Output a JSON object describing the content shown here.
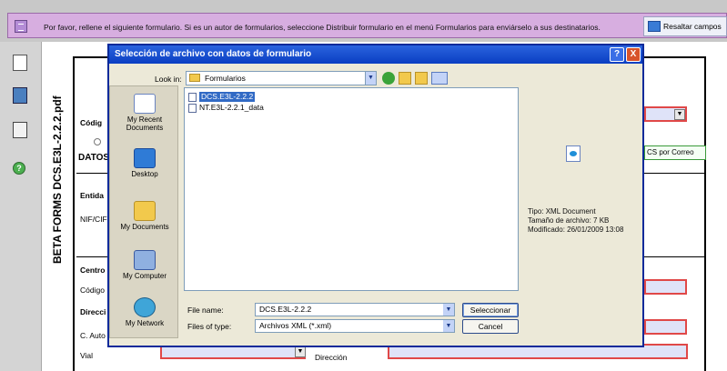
{
  "notice": {
    "text": "Por favor, rellene el siguiente formulario. Si es un autor de formularios, seleccione Distribuir formulario en el menú Formularios para enviárselo a sus destinatarios.",
    "highlight_button": "Resaltar campos"
  },
  "document": {
    "vertical_title": "BETA FORMS DCS.E3L-2.2.2.pdf",
    "labels": {
      "codigo": "Códig",
      "datos": "DATOS",
      "entidad": "Entida",
      "nif": "NIF/CIF",
      "centro": "Centro",
      "codigo2": "Código",
      "direccion_abbr": "Direcci",
      "c_auto": "C. Auto",
      "vial": "Vial",
      "direccion": "Dirección"
    },
    "email_button": "CS por Correo"
  },
  "dialog": {
    "title": "Selección de archivo con datos de formulario",
    "help": "?",
    "close": "X",
    "look_in_label": "Look in:",
    "look_in_value": "Formularios",
    "places": [
      "My Recent Documents",
      "Desktop",
      "My Documents",
      "My Computer",
      "My Network"
    ],
    "files": [
      "DCS.E3L-2.2.2",
      "NT.E3L-2.2.1_data"
    ],
    "preview": {
      "type": "Tipo: XML Document",
      "size": "Tamaño de archivo: 7 KB",
      "modified": "Modificado: 26/01/2009 13:08"
    },
    "file_name_label": "File name:",
    "file_name_value": "DCS.E3L-2.2.2",
    "file_type_label": "Files of type:",
    "file_type_value": "Archivos XML (*.xml)",
    "select_button": "Seleccionar",
    "cancel_button": "Cancel"
  },
  "colors": {
    "notice_bg": "#d7aee0",
    "titlebar": "#0a3ec2",
    "field_border": "#e04848",
    "field_bg": "#dfe3f8"
  }
}
